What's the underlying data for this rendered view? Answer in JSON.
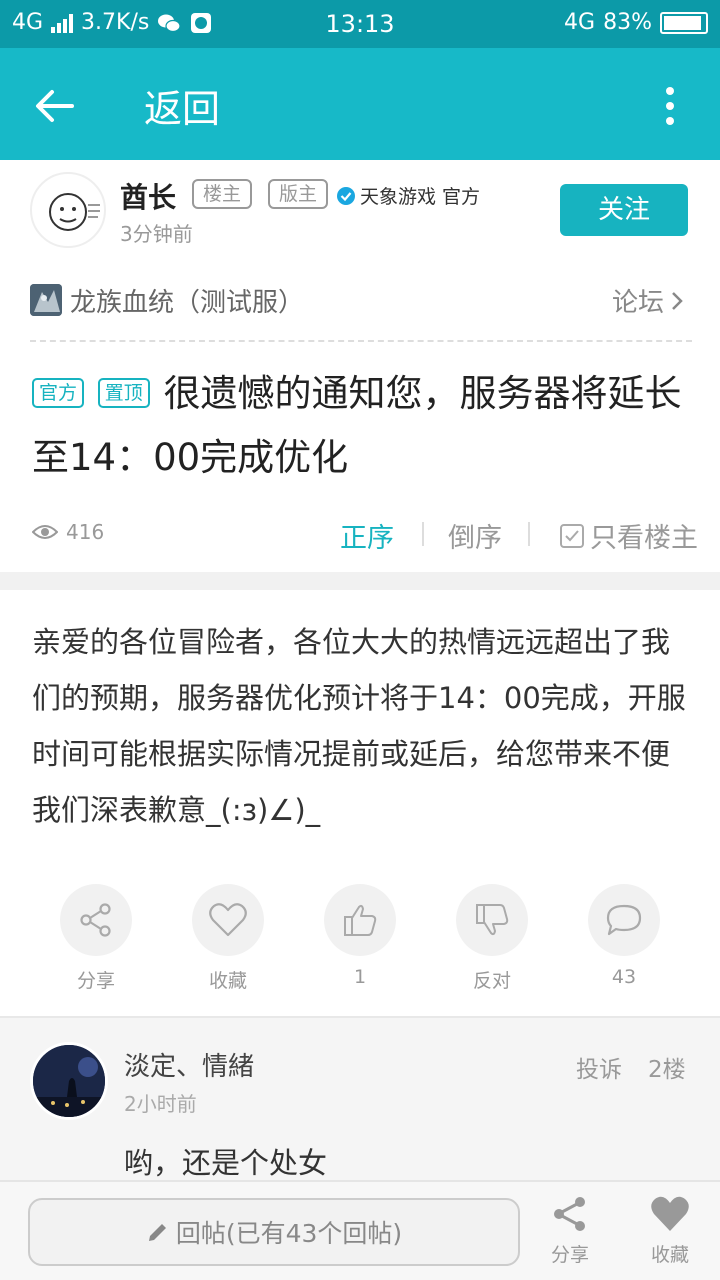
{
  "status_bar": {
    "network": "4G",
    "speed": "3.7K/s",
    "time": "13:13",
    "network_right": "4G",
    "battery": "83%",
    "battery_level": 0.83
  },
  "nav": {
    "back_label": "返回"
  },
  "author": {
    "name": "酋长",
    "tag_owner": "楼主",
    "tag_moderator": "版主",
    "verified_text": "天象游戏 官方",
    "time": "3分钟前",
    "follow_label": "关注"
  },
  "forum": {
    "name": "龙族血统（测试服）",
    "link_label": "论坛"
  },
  "post": {
    "tag_official": "官方",
    "tag_pinned": "置顶",
    "title": "很遗憾的通知您，服务器将延长至14：00完成优化",
    "views": "416",
    "order_asc": "正序",
    "order_desc": "倒序",
    "owner_only": "只看楼主",
    "body": "亲爱的各位冒险者，各位大大的热情远远超出了我们的预期，服务器优化预计将于14：00完成，开服时间可能根据实际情况提前或延后，给您带来不便我们深表歉意_(:з)∠)_"
  },
  "actions": {
    "share": "分享",
    "favorite": "收藏",
    "like_count": "1",
    "oppose": "反对",
    "comment_count": "43"
  },
  "reply": {
    "name": "淡定、情緒",
    "time": "2小时前",
    "report": "投诉",
    "floor": "2楼",
    "text": "哟，还是个处女"
  },
  "bottom": {
    "reply_placeholder": "回帖(已有43个回帖)",
    "share": "分享",
    "favorite": "收藏"
  },
  "colors": {
    "accent": "#17b9c8",
    "status_bar": "#0c9aa8"
  }
}
